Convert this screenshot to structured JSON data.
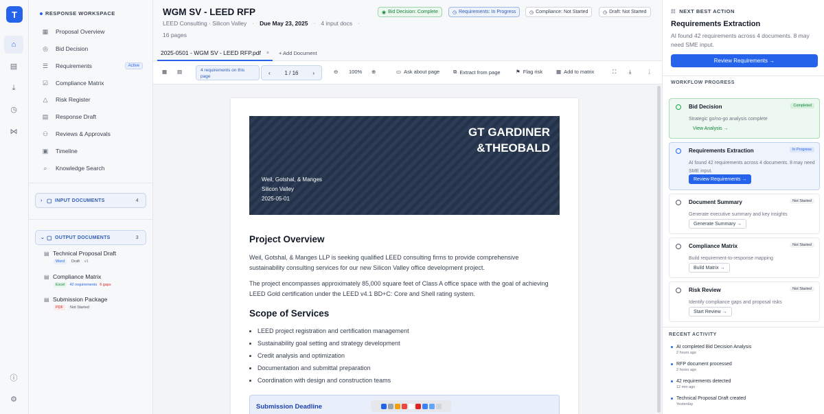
{
  "app": {
    "logo": "T"
  },
  "rail": [
    "home-icon",
    "document-icon",
    "download-icon",
    "clock-icon",
    "share-icon",
    "info-icon",
    "settings-icon"
  ],
  "sidebar": {
    "workspace": "RESPONSE WORKSPACE",
    "items": [
      {
        "label": "Proposal Overview",
        "icon": "grid-icon"
      },
      {
        "label": "Bid Decision",
        "icon": "target-icon"
      },
      {
        "label": "Requirements",
        "icon": "list-icon",
        "tag": "Active"
      },
      {
        "label": "Compliance Matrix",
        "icon": "check-icon"
      },
      {
        "label": "Risk Register",
        "icon": "warning-icon"
      },
      {
        "label": "Response Draft",
        "icon": "document-icon"
      },
      {
        "label": "Reviews & Approvals",
        "icon": "users-icon"
      },
      {
        "label": "Timeline",
        "icon": "calendar-icon"
      },
      {
        "label": "Knowledge Search",
        "icon": "search-icon"
      }
    ],
    "input_docs": {
      "label": "INPUT DOCUMENTS",
      "count": "4"
    },
    "output_docs": {
      "label": "OUTPUT DOCUMENTS",
      "count": "3"
    },
    "outputs": [
      {
        "name": "Technical Proposal Draft",
        "t1": "Word",
        "t2": "Draft",
        "t3": "v1"
      },
      {
        "name": "Compliance Matrix",
        "t1": "Excel",
        "t2": "42 requirements",
        "t3": "6 gaps"
      },
      {
        "name": "Submission Package",
        "t1": "PDF",
        "t2": "Not Started",
        "t3": ""
      }
    ]
  },
  "header": {
    "title": "WGM SV - LEED RFP",
    "client": "LEED Consulting · Silicon Valley",
    "due": "Due May 23, 2025",
    "docs": "4 input docs",
    "pages": "16 pages",
    "statuses": [
      "Bid Decision: Complete",
      "Requirements: In Progress",
      "Compliance: Not Started",
      "Draft: Not Started"
    ]
  },
  "tabs": {
    "file": "2025-0501 - WGM SV - LEED RFP.pdf",
    "close": "×",
    "add": "+ Add Document"
  },
  "toolbar": {
    "req_count": "4 requirements on this page",
    "page": "1 / 16",
    "zoom": "100%",
    "ask": "Ask about page",
    "extract": "Extract from page",
    "flag": "Flag risk",
    "matrix": "Add to matrix"
  },
  "document": {
    "brand1": "GT GARDINER",
    "brand2": "&THEOBALD",
    "client": "Weil, Gotshal, & Manges",
    "location": "Silicon Valley",
    "date": "2025-05-01",
    "h_overview": "Project Overview",
    "p1": "Weil, Gotshal, & Manges LLP is seeking qualified LEED consulting firms to provide comprehensive sustainability consulting services for our new Silicon Valley office development project.",
    "p2": "The project encompasses approximately 85,000 square feet of Class A office space with the goal of achieving LEED Gold certification under the LEED v4.1 BD+C: Core and Shell rating system.",
    "h_scope": "Scope of Services",
    "scope": [
      "LEED project registration and certification management",
      "Sustainability goal setting and strategy development",
      "Credit analysis and optimization",
      "Documentation and submittal preparation",
      "Coordination with design and construction teams"
    ],
    "deadline": "Submission Deadline"
  },
  "right": {
    "nba": "NEXT BEST ACTION",
    "title": "Requirements Extraction",
    "desc": "AI found 42 requirements across 4 documents. 8 may need SME input.",
    "btn": "Review Requirements →",
    "wp": "WORKFLOW PROGRESS",
    "steps": [
      {
        "name": "Bid Decision",
        "status": "Completed",
        "desc": "Strategic go/no-go analysis complete",
        "btn": "View Analysis →"
      },
      {
        "name": "Requirements Extraction",
        "status": "In Progress",
        "desc": "AI found 42 requirements across 4 documents. 8 may need SME input.",
        "btn": "Review Requirements →"
      },
      {
        "name": "Document Summary",
        "status": "Not Started",
        "desc": "Generate executive summary and key insights",
        "btn": "Generate Summary →"
      },
      {
        "name": "Compliance Matrix",
        "status": "Not Started",
        "desc": "Build requirement-to-response mapping",
        "btn": "Build Matrix →"
      },
      {
        "name": "Risk Review",
        "status": "Not Started",
        "desc": "Identify compliance gaps and proposal risks",
        "btn": "Start Review →"
      }
    ],
    "ra": "RECENT ACTIVITY",
    "activity": [
      {
        "text": "AI completed Bid Decision Analysis",
        "when": "2 hours ago"
      },
      {
        "text": "RFP document processed",
        "when": "2 hours ago"
      },
      {
        "text": "42 requirements detected",
        "when": "12 min ago"
      },
      {
        "text": "Technical Proposal Draft created",
        "when": "Yesterday"
      }
    ]
  }
}
